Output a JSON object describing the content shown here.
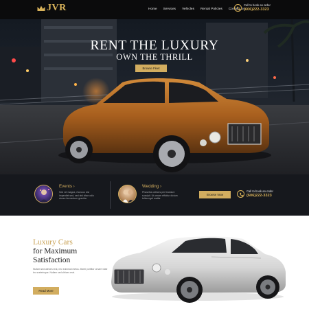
{
  "brand": {
    "logo_text": "JVR"
  },
  "nav": {
    "items": [
      "Home",
      "Services",
      "Vehicles",
      "Rental Policies",
      "Contact Us"
    ]
  },
  "call": {
    "label": "Call to book an order",
    "number": "(606)222-3323"
  },
  "hero": {
    "title": "RENT THE LUXURY",
    "subtitle": "OWN THE THRILL",
    "button_label": "Browse Fleet"
  },
  "services": [
    {
      "title": "Events",
      "text": "Sed vel magna, rhoncus nisi imperdiet sed, sed nisl vitae odio donec fermentum gravida."
    },
    {
      "title": "Wedding",
      "text": "Phasellus ultrices per tincidunt suscipit. Ut ornare efficitur dictum tellus eget mattis."
    }
  ],
  "strip": {
    "book_button": "Browse Now",
    "call_label": "Call to book an order",
    "call_number": "(606)222-3323"
  },
  "section2": {
    "title": "Luxury Cars",
    "subtitle": "for Maximum Satisfaction",
    "text": "Nullam sed ultrices erat, nec euismod metus. Morbi porttitor ornare vitae leo scelerisque. Nullam sed ultrices erat.",
    "button_label": "Read More"
  },
  "colors": {
    "accent": "#d2ad5f",
    "nav_bg": "#0b0b0c",
    "strip_bg": "#16181d",
    "hero_car": "#b26a24",
    "white_car": "#dcdcdc"
  }
}
